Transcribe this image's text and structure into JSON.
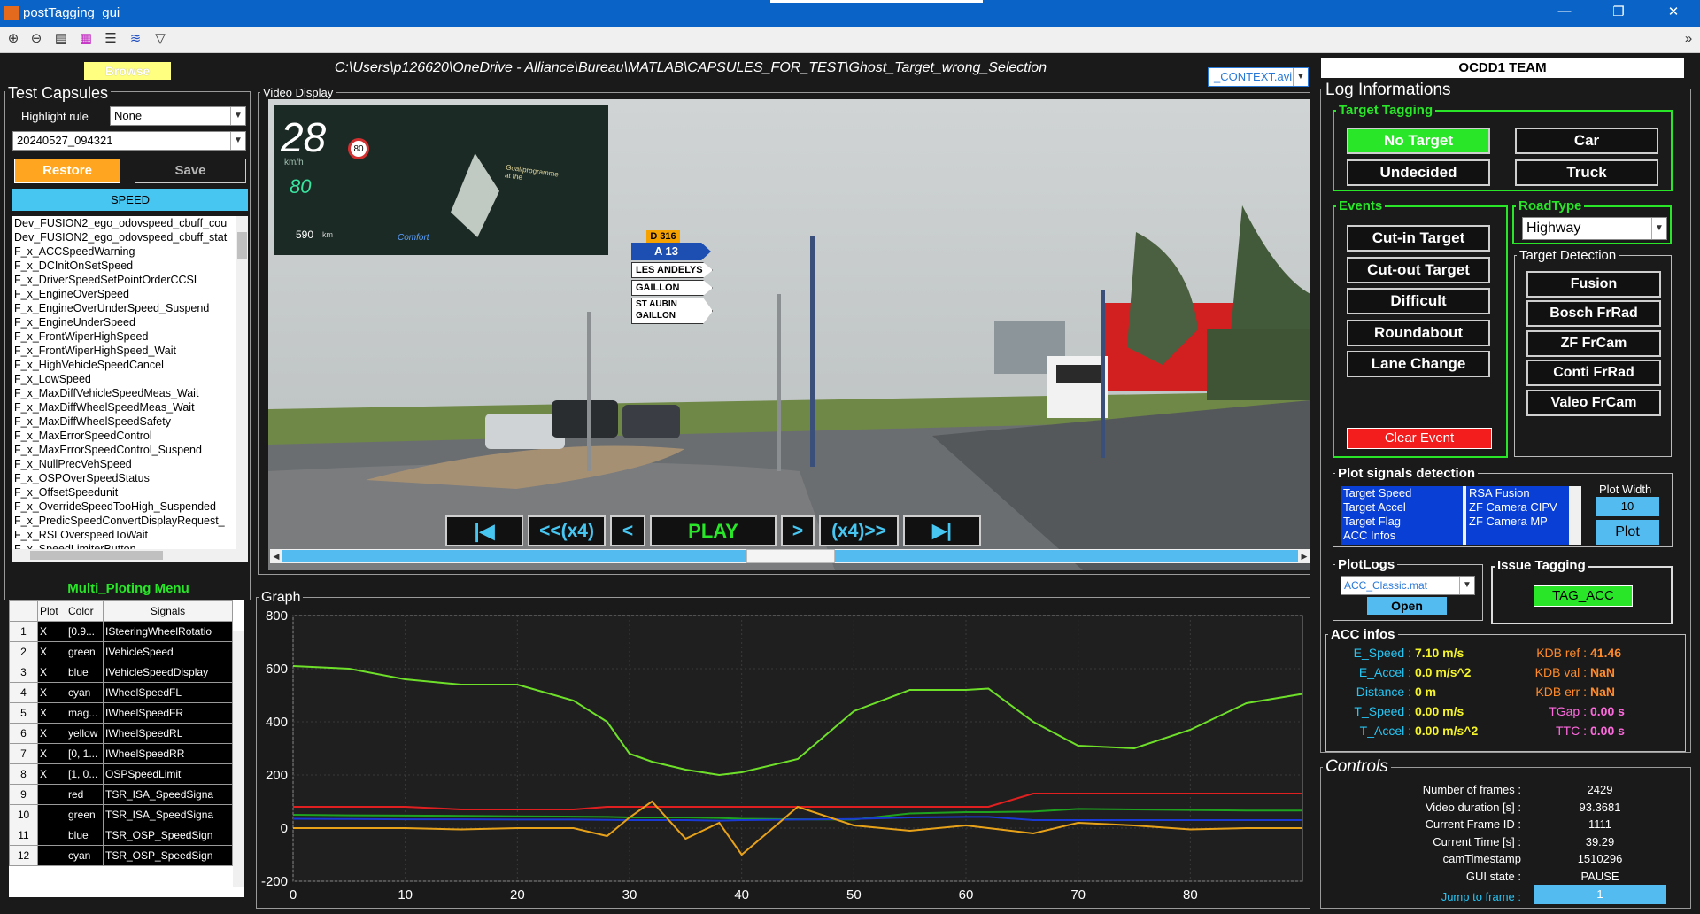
{
  "window": {
    "title": "postTagging_gui"
  },
  "toolbar": {
    "icons": [
      "zoom-in-icon",
      "zoom-out-icon",
      "data-cursor-icon",
      "colorbar-icon",
      "legend-icon",
      "plot-icon",
      "filter-icon"
    ]
  },
  "header": {
    "path": "C:\\Users\\p126620\\OneDrive - Alliance\\Bureau\\MATLAB\\CAPSULES_FOR_TEST\\Ghost_Target_wrong_Selection",
    "video_select": "_CONTEXT.avi",
    "team_label": "OCDD1 TEAM",
    "browse": "Browse"
  },
  "test_capsules": {
    "title": "Test Capsules",
    "highlight_label": "Highlight rule",
    "highlight_value": "None",
    "capsule_value": "20240527_094321",
    "restore": "Restore",
    "save": "Save",
    "speed_button": "SPEED",
    "signals": [
      "Dev_FUSION2_ego_odovspeed_cbuff_cou",
      "Dev_FUSION2_ego_odovspeed_cbuff_stat",
      "F_x_ACCSpeedWarning",
      "F_x_DCInitOnSetSpeed",
      "F_x_DriverSpeedSetPointOrderCCSL",
      "F_x_EngineOverSpeed",
      "F_x_EngineOverUnderSpeed_Suspend",
      "F_x_EngineUnderSpeed",
      "F_x_FrontWiperHighSpeed",
      "F_x_FrontWiperHighSpeed_Wait",
      "F_x_HighVehicleSpeedCancel",
      "F_x_LowSpeed",
      "F_x_MaxDiffVehicleSpeedMeas_Wait",
      "F_x_MaxDiffWheelSpeedMeas_Wait",
      "F_x_MaxDiffWheelSpeedSafety",
      "F_x_MaxErrorSpeedControl",
      "F_x_MaxErrorSpeedControl_Suspend",
      "F_x_NullPrecVehSpeed",
      "F_x_OSPOverSpeedStatus",
      "F_x_OffsetSpeedunit",
      "F_x_OverrideSpeedTooHigh_Suspended",
      "F_x_PredicSpeedConvertDisplayRequest_",
      "F_x_RSLOverspeedToWait",
      "F_x_SpeedLimiterButton"
    ]
  },
  "multi_plot": {
    "title": "Multi_Ploting Menu",
    "headers": [
      "Plot",
      "Color",
      "Signals"
    ],
    "rows": [
      {
        "n": "1",
        "plot": "X",
        "color": "[0.9...",
        "signal": "ISteeringWheelRotatio"
      },
      {
        "n": "2",
        "plot": "X",
        "color": "green",
        "signal": "IVehicleSpeed"
      },
      {
        "n": "3",
        "plot": "X",
        "color": "blue",
        "signal": "IVehicleSpeedDisplay"
      },
      {
        "n": "4",
        "plot": "X",
        "color": "cyan",
        "signal": "IWheelSpeedFL"
      },
      {
        "n": "5",
        "plot": "X",
        "color": "mag...",
        "signal": "IWheelSpeedFR"
      },
      {
        "n": "6",
        "plot": "X",
        "color": "yellow",
        "signal": "IWheelSpeedRL"
      },
      {
        "n": "7",
        "plot": "X",
        "color": "[0, 1...",
        "signal": "IWheelSpeedRR"
      },
      {
        "n": "8",
        "plot": "X",
        "color": "[1, 0...",
        "signal": "OSPSpeedLimit"
      },
      {
        "n": "9",
        "plot": "",
        "color": "red",
        "signal": "TSR_ISA_SpeedSigna"
      },
      {
        "n": "10",
        "plot": "",
        "color": "green",
        "signal": "TSR_ISA_SpeedSigna"
      },
      {
        "n": "11",
        "plot": "",
        "color": "blue",
        "signal": "TSR_OSP_SpeedSign"
      },
      {
        "n": "12",
        "plot": "",
        "color": "cyan",
        "signal": "TSR_OSP_SpeedSign"
      }
    ]
  },
  "video": {
    "title": "Video Display",
    "speed": "28",
    "unit": "km/h",
    "set_speed": "80",
    "limit": "80",
    "range": "590",
    "range_unit": "km",
    "mode": "Comfort",
    "goal": "Goal/programme\nat the",
    "signs": {
      "road": "D 316",
      "a13": "A 13",
      "s1": "LES ANDELYS",
      "s2": "GAILLON",
      "s3": "ST AUBIN",
      "s4": "GAILLON"
    },
    "controls": {
      "first": "|◀",
      "rew": "<<(x4)",
      "prev": "<",
      "play": "PLAY",
      "next": ">",
      "fwd": "(x4)>>",
      "last": "▶|"
    },
    "progress": 0.5
  },
  "graph": {
    "title": "Graph"
  },
  "chart_data": {
    "type": "line",
    "x": [
      0,
      5,
      10,
      15,
      20,
      25,
      28,
      30,
      32,
      35,
      38,
      40,
      45,
      50,
      55,
      60,
      62,
      66,
      70,
      75,
      80,
      85,
      90
    ],
    "series": [
      {
        "color": "#6ee02a",
        "values": [
          610,
          600,
          560,
          540,
          540,
          480,
          400,
          280,
          250,
          220,
          200,
          210,
          260,
          440,
          520,
          520,
          525,
          400,
          310,
          300,
          370,
          470,
          505
        ]
      },
      {
        "color": "#1fa31f",
        "values": [
          50,
          48,
          47,
          46,
          44,
          43,
          42,
          40,
          40,
          40,
          38,
          35,
          33,
          32,
          55,
          60,
          60,
          62,
          72,
          70,
          68,
          66,
          66
        ]
      },
      {
        "color": "#1a3ad6",
        "values": [
          35,
          34,
          33,
          33,
          32,
          32,
          31,
          30,
          30,
          30,
          28,
          30,
          32,
          34,
          40,
          42,
          42,
          30,
          30,
          30,
          30,
          30,
          30
        ]
      },
      {
        "color": "#e02020",
        "values": [
          80,
          80,
          80,
          70,
          70,
          70,
          80,
          80,
          80,
          80,
          80,
          80,
          80,
          80,
          80,
          80,
          80,
          130,
          130,
          130,
          130,
          130,
          130
        ]
      },
      {
        "color": "#e8a21a",
        "values": [
          0,
          0,
          0,
          -5,
          0,
          0,
          -30,
          40,
          100,
          -40,
          20,
          -100,
          80,
          10,
          -10,
          10,
          0,
          -20,
          20,
          10,
          -5,
          0,
          0
        ]
      }
    ],
    "xlim": [
      0,
      90
    ],
    "ylim": [
      -200,
      800
    ],
    "xticks": [
      "0",
      "10",
      "20",
      "30",
      "40",
      "50",
      "60",
      "70",
      "80"
    ],
    "yticks": [
      "800",
      "600",
      "400",
      "200",
      "0",
      "-200"
    ]
  },
  "log": {
    "title": "Log Informations",
    "target_tagging": {
      "title": "Target Tagging",
      "no_target": "No Target",
      "car": "Car",
      "undecided": "Undecided",
      "truck": "Truck"
    },
    "events": {
      "title": "Events",
      "items": [
        "Cut-in Target",
        "Cut-out Target",
        "Difficult",
        "Roundabout",
        "Lane Change"
      ],
      "clear": "Clear Event"
    },
    "roadtype": {
      "title": "RoadType",
      "value": "Highway"
    },
    "target_detection": {
      "title": "Target Detection",
      "items": [
        "Fusion",
        "Bosch FrRad",
        "ZF FrCam",
        "Conti FrRad",
        "Valeo FrCam"
      ]
    },
    "plot_signals": {
      "title": "Plot signals detection",
      "list1": [
        "Target Speed",
        "Target Accel",
        "Target Flag",
        "ACC Infos"
      ],
      "list2": [
        "RSA Fusion",
        "ZF Camera CIPV",
        "ZF Camera MP"
      ],
      "width_label": "Plot Width",
      "width_value": "10",
      "plot": "Plot"
    },
    "plotlogs": {
      "title": "PlotLogs",
      "value": "ACC_Classic.mat",
      "open": "Open"
    },
    "issue": {
      "title": "Issue Tagging",
      "button": "TAG_ACC"
    },
    "acc": {
      "title": "ACC infos",
      "left": [
        {
          "k": "E_Speed :",
          "v": "7.10 m/s"
        },
        {
          "k": "E_Accel :",
          "v": "0.0 m/s^2"
        },
        {
          "k": "Distance :",
          "v": "0 m"
        },
        {
          "k": "T_Speed :",
          "v": "0.00 m/s"
        },
        {
          "k": "T_Accel :",
          "v": "0.00 m/s^2"
        }
      ],
      "right": [
        {
          "k": "KDB  ref :",
          "v": "41.46"
        },
        {
          "k": "KDB  val :",
          "v": "NaN"
        },
        {
          "k": "KDB  err :",
          "v": "NaN"
        },
        {
          "k": "TGap :",
          "v": "0.00 s"
        },
        {
          "k": "TTC :",
          "v": "0.00 s"
        }
      ]
    }
  },
  "controls": {
    "title": "Controls",
    "rows": [
      {
        "k": "Number of frames :",
        "v": "2429"
      },
      {
        "k": "Video duration [s] :",
        "v": "93.3681"
      },
      {
        "k": "Current Frame ID :",
        "v": "1111"
      },
      {
        "k": "Current Time [s] :",
        "v": "39.29"
      },
      {
        "k": "camTimestamp",
        "v": "1510296"
      },
      {
        "k": "GUI state :",
        "v": "PAUSE"
      }
    ],
    "jump_label": "Jump to frame :",
    "jump_value": "1"
  }
}
